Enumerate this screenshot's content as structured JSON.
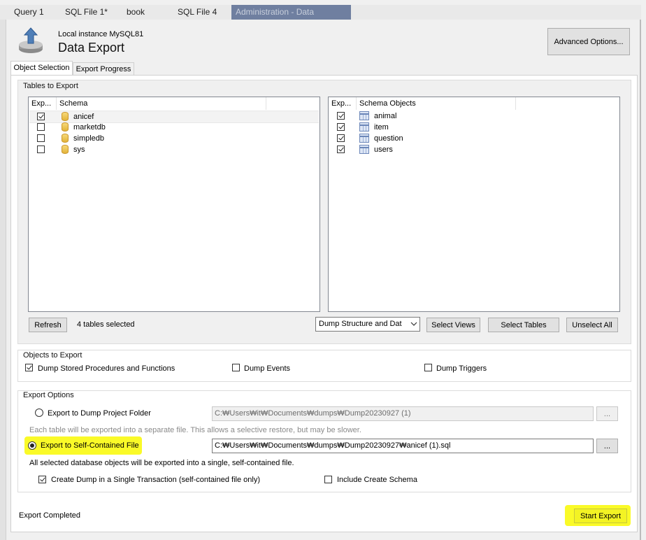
{
  "tabs": [
    {
      "label": "Query 1"
    },
    {
      "label": "SQL File 1*"
    },
    {
      "label": "book"
    },
    {
      "label": "SQL File 4"
    },
    {
      "label": "Administration - Data Export",
      "close": "×"
    }
  ],
  "header": {
    "instance": "Local instance MySQL81",
    "title": "Data Export",
    "advanced_button": "Advanced Options..."
  },
  "subtabs": [
    {
      "label": "Object Selection"
    },
    {
      "label": "Export Progress"
    }
  ],
  "tables_group": {
    "title": "Tables to Export",
    "left_list": {
      "col_export": "Exp...",
      "col_name": "Schema",
      "rows": [
        {
          "name": "anicef",
          "checked": true,
          "icon": "database-icon"
        },
        {
          "name": "marketdb",
          "checked": false,
          "icon": "database-icon"
        },
        {
          "name": "simpledb",
          "checked": false,
          "icon": "database-icon"
        },
        {
          "name": "sys",
          "checked": false,
          "icon": "database-icon"
        }
      ]
    },
    "right_list": {
      "col_export": "Exp...",
      "col_name": "Schema Objects",
      "rows": [
        {
          "name": "animal",
          "checked": true,
          "icon": "table-icon"
        },
        {
          "name": "item",
          "checked": true,
          "icon": "table-icon"
        },
        {
          "name": "question",
          "checked": true,
          "icon": "table-icon"
        },
        {
          "name": "users",
          "checked": true,
          "icon": "table-icon"
        }
      ]
    },
    "refresh_button": "Refresh",
    "selected_count": "4 tables selected",
    "dump_mode": "Dump Structure and Dat",
    "select_views_button": "Select Views",
    "select_tables_button": "Select Tables",
    "unselect_all_button": "Unselect All"
  },
  "objects_group": {
    "title": "Objects to Export",
    "dump_procedures": {
      "label": "Dump Stored Procedures and Functions",
      "checked": true
    },
    "dump_events": {
      "label": "Dump Events",
      "checked": false
    },
    "dump_triggers": {
      "label": "Dump Triggers",
      "checked": false
    }
  },
  "options_group": {
    "title": "Export Options",
    "project_folder": {
      "label": "Export to Dump Project Folder",
      "selected": false,
      "path": "C:₩Users₩it₩Documents₩dumps₩Dump20230927 (1)",
      "browse": "..."
    },
    "project_hint": "Each table will be exported into a separate file. This allows a selective restore, but may be slower.",
    "self_contained": {
      "label": "Export to Self-Contained File",
      "selected": true,
      "path": "C:₩Users₩it₩Documents₩dumps₩Dump20230927₩anicef (1).sql",
      "browse": "..."
    },
    "self_hint": "All selected database objects will be exported into a single, self-contained file.",
    "single_transaction": {
      "label": "Create Dump in a Single Transaction (self-contained file only)",
      "checked": true
    },
    "include_schema": {
      "label": "Include Create Schema",
      "checked": false
    }
  },
  "status": "Export Completed",
  "start_export_button": "Start Export",
  "colors": {
    "highlight": "#fafa28",
    "active_tab": "#6f7fa0"
  }
}
